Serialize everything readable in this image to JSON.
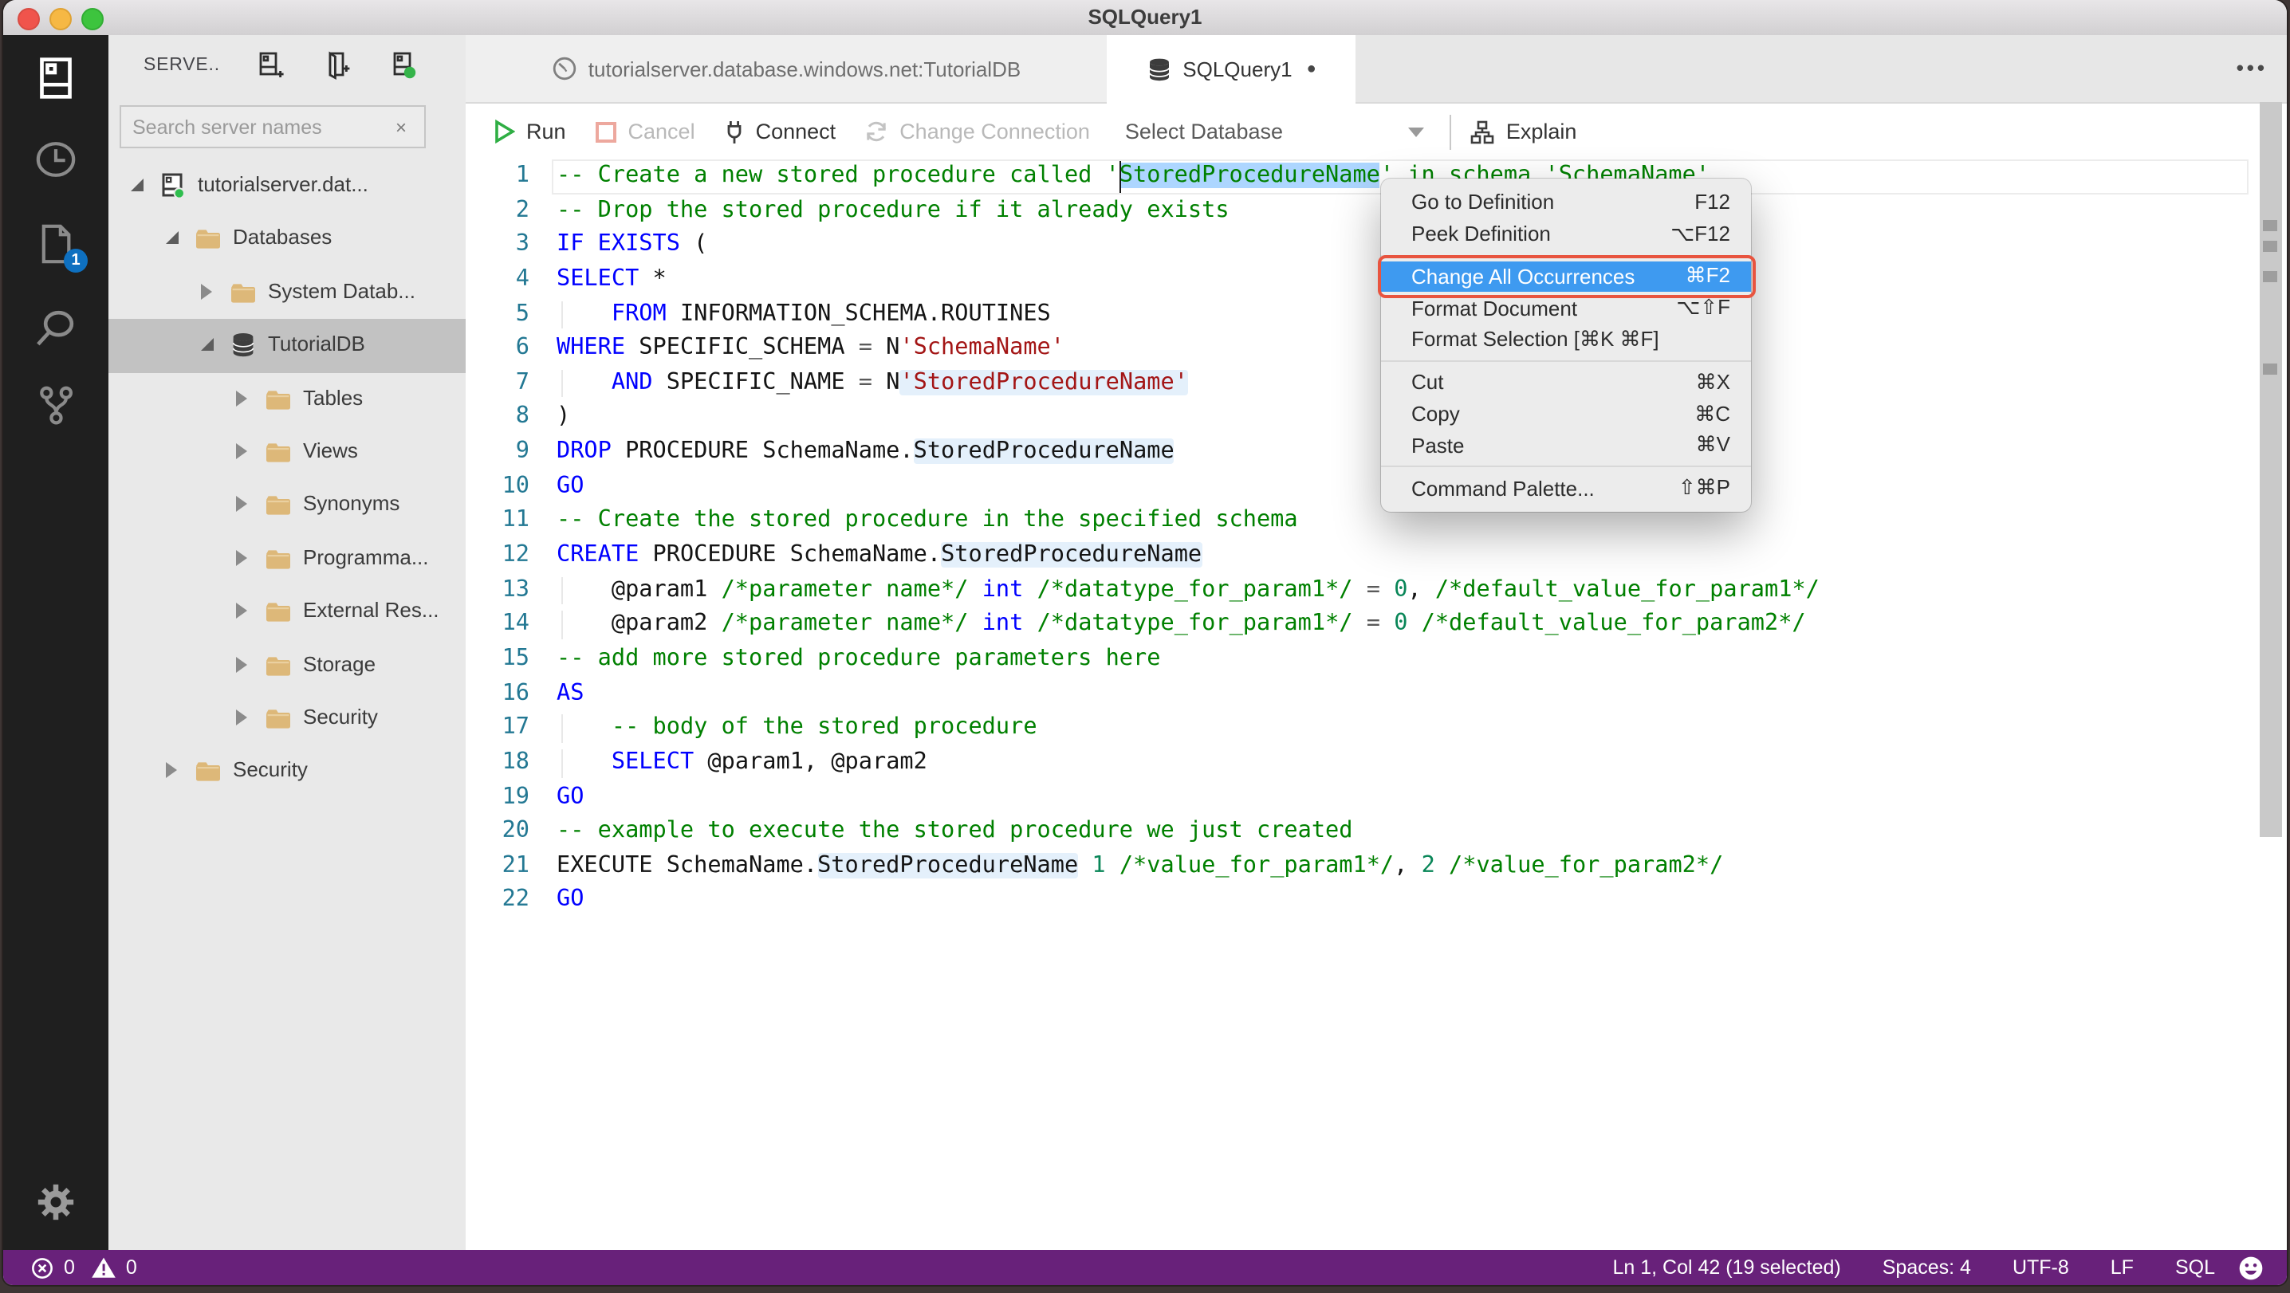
{
  "window": {
    "title": "SQLQuery1"
  },
  "colors": {
    "statusbar": "#68217A",
    "selection": "#ADD6FF",
    "occurrence": "#E4F0FB",
    "menu-highlight": "#3E9AF0",
    "annotation": "#E8543F",
    "keyword": "#0000FF",
    "comment": "#008000",
    "string": "#A31515",
    "number": "#098658",
    "lineno": "#237893",
    "badge": "#0E70C0",
    "folder": "#DDB879",
    "traffic-red": "#F0544C",
    "traffic-yellow": "#F6B844",
    "traffic-green": "#3DC43E"
  },
  "activity_bar": {
    "items": [
      "servers",
      "task-history",
      "open-editors",
      "search",
      "source-control"
    ],
    "open_editors_badge": "1",
    "bottom": [
      "settings"
    ]
  },
  "sidebar": {
    "header": "SERVE..",
    "header_icons": [
      "new-connection",
      "new-server-group",
      "active-connections"
    ],
    "search": {
      "placeholder": "Search server names",
      "clear_icon": "×"
    },
    "tree": [
      {
        "label": "tutorialserver.dat...",
        "level": 0,
        "state": "expanded",
        "icon": "server"
      },
      {
        "label": "Databases",
        "level": 1,
        "state": "expanded",
        "icon": "folder"
      },
      {
        "label": "System Datab...",
        "level": 2,
        "state": "collapsed",
        "icon": "folder"
      },
      {
        "label": "TutorialDB",
        "level": 2,
        "state": "expanded",
        "icon": "database",
        "selected": true
      },
      {
        "label": "Tables",
        "level": 3,
        "state": "collapsed",
        "icon": "folder"
      },
      {
        "label": "Views",
        "level": 3,
        "state": "collapsed",
        "icon": "folder"
      },
      {
        "label": "Synonyms",
        "level": 3,
        "state": "collapsed",
        "icon": "folder"
      },
      {
        "label": "Programma...",
        "level": 3,
        "state": "collapsed",
        "icon": "folder"
      },
      {
        "label": "External Res...",
        "level": 3,
        "state": "collapsed",
        "icon": "folder"
      },
      {
        "label": "Storage",
        "level": 3,
        "state": "collapsed",
        "icon": "folder"
      },
      {
        "label": "Security",
        "level": 3,
        "state": "collapsed",
        "icon": "folder"
      },
      {
        "label": "Security",
        "level": 1,
        "state": "collapsed",
        "icon": "folder"
      }
    ]
  },
  "tabs": [
    {
      "label": "tutorialserver.database.windows.net:TutorialDB",
      "icon": "dashboard",
      "active": false,
      "dirty": false
    },
    {
      "label": "SQLQuery1",
      "icon": "database",
      "active": true,
      "dirty": true
    }
  ],
  "toolbar": {
    "run": "Run",
    "cancel": "Cancel",
    "connect": "Connect",
    "change_connection": "Change Connection",
    "select_database": "Select Database",
    "explain": "Explain"
  },
  "editor": {
    "lines": [
      [
        {
          "t": "-- Create a new stored procedure called '",
          "c": "c"
        },
        {
          "t": "StoredProcedureName",
          "c": "c",
          "sel": true
        },
        {
          "t": "' in schema 'SchemaName'",
          "c": "c"
        }
      ],
      [
        {
          "t": "-- Drop the stored procedure if it already exists",
          "c": "c"
        }
      ],
      [
        {
          "t": "IF EXISTS",
          "c": "k"
        },
        {
          "t": " (",
          "c": "p"
        }
      ],
      [
        {
          "t": "SELECT",
          "c": "k"
        },
        {
          "t": " *",
          "c": "p"
        }
      ],
      [
        {
          "t": "    ",
          "c": "p",
          "g": true
        },
        {
          "t": "FROM",
          "c": "k"
        },
        {
          "t": " INFORMATION_SCHEMA.ROUTINES",
          "c": "p"
        }
      ],
      [
        {
          "t": "WHERE",
          "c": "k"
        },
        {
          "t": " SPECIFIC_SCHEMA ",
          "c": "p"
        },
        {
          "t": "=",
          "c": "o"
        },
        {
          "t": " N",
          "c": "p"
        },
        {
          "t": "'SchemaName'",
          "c": "s"
        }
      ],
      [
        {
          "t": "    ",
          "c": "p",
          "g": true
        },
        {
          "t": "AND",
          "c": "k"
        },
        {
          "t": " SPECIFIC_NAME ",
          "c": "p"
        },
        {
          "t": "=",
          "c": "o"
        },
        {
          "t": " N",
          "c": "p"
        },
        {
          "t": "'StoredProcedureName'",
          "c": "s",
          "hl": true
        }
      ],
      [
        {
          "t": ")",
          "c": "p"
        }
      ],
      [
        {
          "t": "DROP",
          "c": "k"
        },
        {
          "t": " PROCEDURE SchemaName.",
          "c": "p"
        },
        {
          "t": "StoredProcedureName",
          "c": "p",
          "hl": true
        }
      ],
      [
        {
          "t": "GO",
          "c": "k"
        }
      ],
      [
        {
          "t": "-- Create the stored procedure in the specified schema",
          "c": "c"
        }
      ],
      [
        {
          "t": "CREATE",
          "c": "k"
        },
        {
          "t": " PROCEDURE SchemaName.",
          "c": "p"
        },
        {
          "t": "StoredProcedureName",
          "c": "p",
          "hl": true
        }
      ],
      [
        {
          "t": "    @param1 ",
          "c": "p",
          "g": true
        },
        {
          "t": "/*parameter name*/",
          "c": "c"
        },
        {
          "t": " ",
          "c": "p"
        },
        {
          "t": "int",
          "c": "k"
        },
        {
          "t": " ",
          "c": "p"
        },
        {
          "t": "/*datatype_for_param1*/",
          "c": "c"
        },
        {
          "t": " ",
          "c": "p"
        },
        {
          "t": "=",
          "c": "o"
        },
        {
          "t": " ",
          "c": "p"
        },
        {
          "t": "0",
          "c": "n"
        },
        {
          "t": ", ",
          "c": "p"
        },
        {
          "t": "/*default_value_for_param1*/",
          "c": "c"
        }
      ],
      [
        {
          "t": "    @param2 ",
          "c": "p",
          "g": true
        },
        {
          "t": "/*parameter name*/",
          "c": "c"
        },
        {
          "t": " ",
          "c": "p"
        },
        {
          "t": "int",
          "c": "k"
        },
        {
          "t": " ",
          "c": "p"
        },
        {
          "t": "/*datatype_for_param1*/",
          "c": "c"
        },
        {
          "t": " ",
          "c": "p"
        },
        {
          "t": "=",
          "c": "o"
        },
        {
          "t": " ",
          "c": "p"
        },
        {
          "t": "0",
          "c": "n"
        },
        {
          "t": " ",
          "c": "p"
        },
        {
          "t": "/*default_value_for_param2*/",
          "c": "c"
        }
      ],
      [
        {
          "t": "-- add more stored procedure parameters here",
          "c": "c"
        }
      ],
      [
        {
          "t": "AS",
          "c": "k"
        }
      ],
      [
        {
          "t": "    ",
          "c": "p",
          "g": true
        },
        {
          "t": "-- body of the stored procedure",
          "c": "c"
        }
      ],
      [
        {
          "t": "    ",
          "c": "p",
          "g": true
        },
        {
          "t": "SELECT",
          "c": "k"
        },
        {
          "t": " @param1, @param2",
          "c": "p"
        }
      ],
      [
        {
          "t": "GO",
          "c": "k"
        }
      ],
      [
        {
          "t": "-- example to execute the stored procedure we just created",
          "c": "c"
        }
      ],
      [
        {
          "t": "EXECUTE SchemaName.",
          "c": "p"
        },
        {
          "t": "StoredProcedureName",
          "c": "p",
          "hl": true
        },
        {
          "t": " ",
          "c": "p"
        },
        {
          "t": "1",
          "c": "n"
        },
        {
          "t": " ",
          "c": "p"
        },
        {
          "t": "/*value_for_param1*/",
          "c": "c"
        },
        {
          "t": ", ",
          "c": "p"
        },
        {
          "t": "2",
          "c": "n"
        },
        {
          "t": " ",
          "c": "p"
        },
        {
          "t": "/*value_for_param2*/",
          "c": "c"
        }
      ],
      [
        {
          "t": "GO",
          "c": "k"
        }
      ]
    ],
    "occurrence_marker_lines": [
      7,
      9,
      12,
      21
    ]
  },
  "context_menu": {
    "items": [
      {
        "label": "Go to Definition",
        "shortcut": "F12"
      },
      {
        "label": "Peek Definition",
        "shortcut": "⌥F12"
      },
      {
        "sep": true
      },
      {
        "label": "Change All Occurrences",
        "shortcut": "⌘F2",
        "highlighted": true,
        "annotated": true
      },
      {
        "label": "Format Document",
        "shortcut": "⌥⇧F"
      },
      {
        "label": "Format Selection [⌘K ⌘F]",
        "shortcut": ""
      },
      {
        "sep": true
      },
      {
        "label": "Cut",
        "shortcut": "⌘X"
      },
      {
        "label": "Copy",
        "shortcut": "⌘C"
      },
      {
        "label": "Paste",
        "shortcut": "⌘V"
      },
      {
        "sep": true
      },
      {
        "label": "Command Palette...",
        "shortcut": "⇧⌘P"
      }
    ]
  },
  "status_bar": {
    "errors": "0",
    "warnings": "0",
    "right_items": [
      "Ln 1, Col 42 (19 selected)",
      "Spaces: 4",
      "UTF-8",
      "LF",
      "SQL"
    ]
  }
}
